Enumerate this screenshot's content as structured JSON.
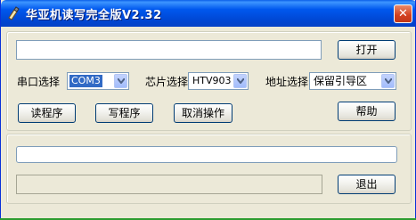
{
  "window": {
    "title": "华亚机读写完全版V2.32"
  },
  "icons": {
    "app": "app-icon",
    "close": "close-icon",
    "dropdown": "chevron-down-icon"
  },
  "main": {
    "path_value": "",
    "open_label": "打开",
    "port": {
      "label": "串口选择",
      "value": "COM3"
    },
    "chip": {
      "label": "芯片选择",
      "value": "HTV903"
    },
    "address": {
      "label": "地址选择",
      "value": "保留引导区"
    },
    "read_label": "读程序",
    "write_label": "写程序",
    "cancel_label": "取消操作",
    "help_label": "帮助"
  },
  "status": {
    "message": "",
    "progress": 0,
    "exit_label": "退出"
  },
  "colors": {
    "titlebar": "#0054e3",
    "face": "#ece9d8",
    "selection": "#316ac5"
  }
}
